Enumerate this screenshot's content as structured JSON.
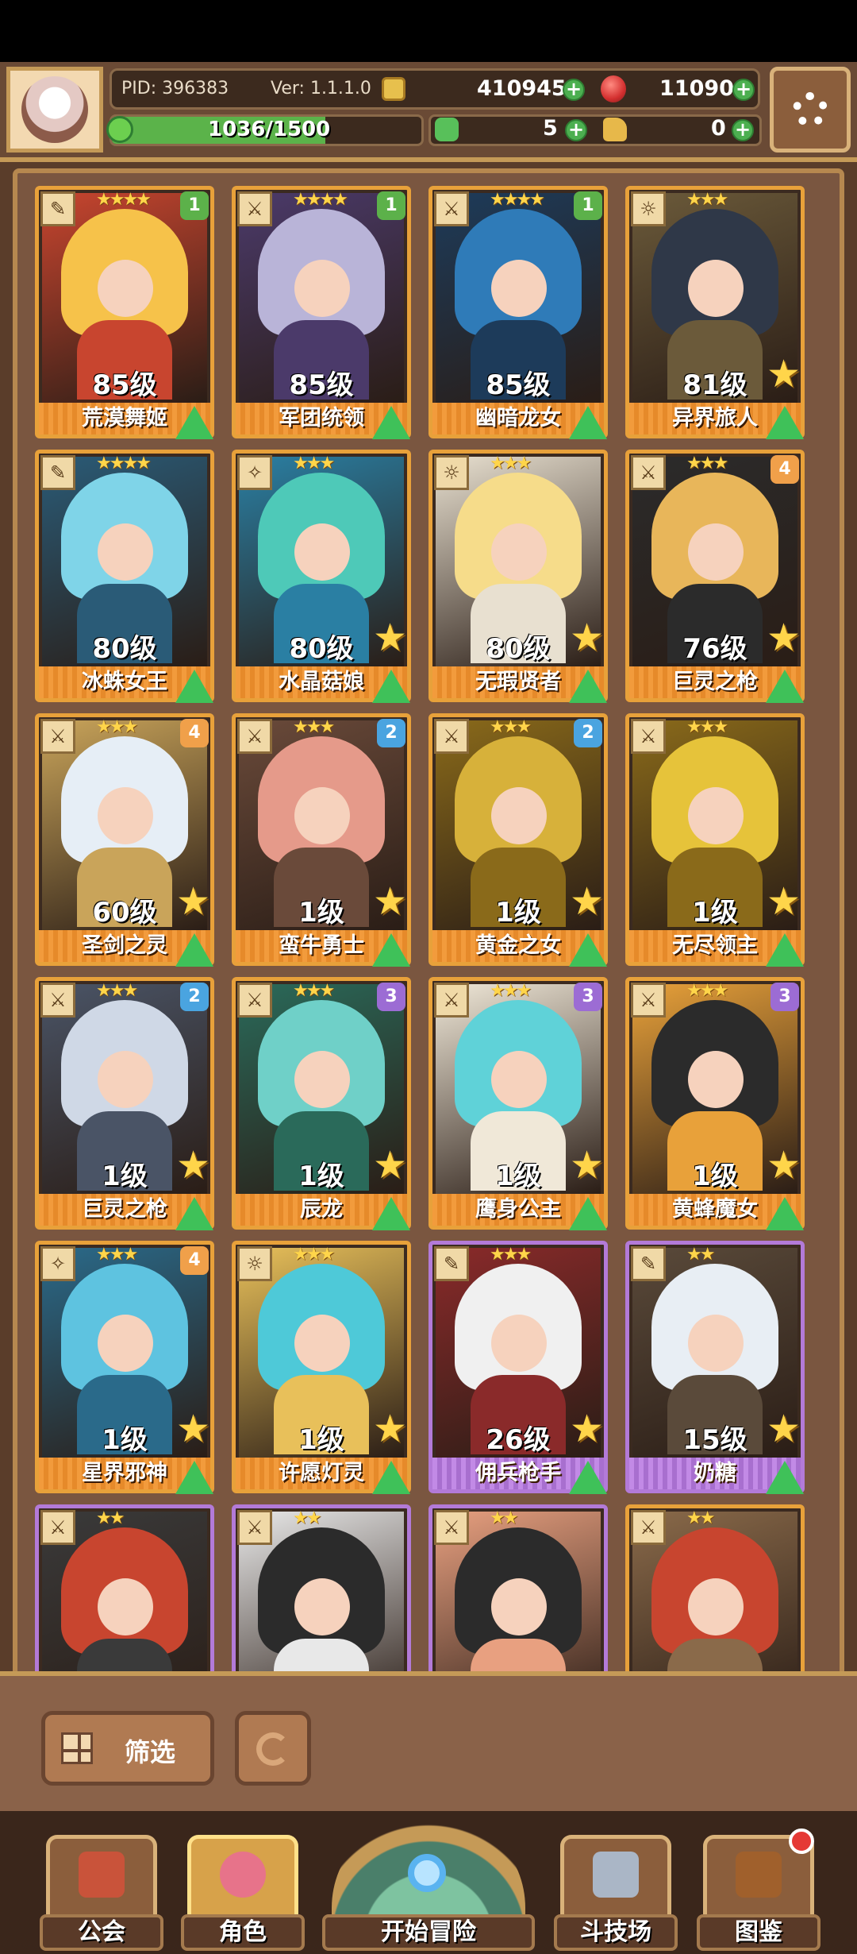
{
  "hud": {
    "pid": "PID: 396383",
    "version": "Ver: 1.1.1.0",
    "coins": "410945",
    "gems": "11090",
    "exp_text": "1036/1500",
    "exp_progress": 0.69,
    "clovers": "5",
    "boots": "0",
    "plus_symbol": "+"
  },
  "cards": [
    {
      "name": "荒漠舞姬",
      "level": "85级",
      "stars": "★★★★",
      "tier": "1",
      "tier_color": "green",
      "frame": "gold",
      "role": "wand",
      "palette": [
        "#f6c24a",
        "#c8452f"
      ],
      "big_star": false
    },
    {
      "name": "军团统领",
      "level": "85级",
      "stars": "★★★★",
      "tier": "1",
      "tier_color": "green",
      "frame": "gold",
      "role": "sword",
      "palette": [
        "#b9b4d8",
        "#4b3a6a"
      ],
      "big_star": false
    },
    {
      "name": "幽暗龙女",
      "level": "85级",
      "stars": "★★★★",
      "tier": "1",
      "tier_color": "green",
      "frame": "gold",
      "role": "sword",
      "palette": [
        "#2f7bb8",
        "#1d3b5a"
      ],
      "big_star": false
    },
    {
      "name": "异界旅人",
      "level": "81级",
      "stars": "★★★",
      "tier": "",
      "tier_color": "",
      "frame": "gold",
      "role": "shield",
      "palette": [
        "#2f3848",
        "#6b5a3a"
      ],
      "big_star": true
    },
    {
      "name": "冰蛛女王",
      "level": "80级",
      "stars": "★★★★",
      "tier": "",
      "tier_color": "",
      "frame": "gold",
      "role": "wand",
      "palette": [
        "#7fd4e8",
        "#2a5b77"
      ],
      "big_star": false
    },
    {
      "name": "水晶菇娘",
      "level": "80级",
      "stars": "★★★",
      "tier": "",
      "tier_color": "",
      "frame": "gold",
      "role": "staff",
      "palette": [
        "#4ec9b8",
        "#2a7fa3"
      ],
      "big_star": true
    },
    {
      "name": "无瑕贤者",
      "level": "80级",
      "stars": "★★★",
      "tier": "",
      "tier_color": "",
      "frame": "gold",
      "role": "shield",
      "palette": [
        "#f6dc8a",
        "#e8e0d0"
      ],
      "big_star": true
    },
    {
      "name": "巨灵之枪",
      "level": "76级",
      "stars": "★★★",
      "tier": "4",
      "tier_color": "orange",
      "frame": "gold",
      "role": "sword",
      "palette": [
        "#e8b65a",
        "#2b2b2b"
      ],
      "big_star": true
    },
    {
      "name": "圣剑之灵",
      "level": "60级",
      "stars": "★★★",
      "tier": "4",
      "tier_color": "orange",
      "frame": "gold",
      "role": "sword",
      "palette": [
        "#e6eef6",
        "#c9a45a"
      ],
      "big_star": true
    },
    {
      "name": "蛮牛勇士",
      "level": "1级",
      "stars": "★★★",
      "tier": "2",
      "tier_color": "blue",
      "frame": "gold",
      "role": "sword",
      "palette": [
        "#e59a8a",
        "#6a4a3a"
      ],
      "big_star": true
    },
    {
      "name": "黄金之女",
      "level": "1级",
      "stars": "★★★",
      "tier": "2",
      "tier_color": "blue",
      "frame": "gold",
      "role": "sword",
      "palette": [
        "#d7b13a",
        "#8a6a1a"
      ],
      "big_star": true
    },
    {
      "name": "无尽领主",
      "level": "1级",
      "stars": "★★★",
      "tier": "",
      "tier_color": "",
      "frame": "gold",
      "role": "sword",
      "palette": [
        "#e6c33a",
        "#8a6a1a"
      ],
      "big_star": true
    },
    {
      "name": "巨灵之枪",
      "level": "1级",
      "stars": "★★★",
      "tier": "2",
      "tier_color": "blue",
      "frame": "gold",
      "role": "sword",
      "palette": [
        "#cfd8e6",
        "#4a5466"
      ],
      "big_star": true
    },
    {
      "name": "辰龙",
      "level": "1级",
      "stars": "★★★",
      "tier": "3",
      "tier_color": "violet",
      "frame": "gold",
      "role": "sword",
      "palette": [
        "#6fd0c8",
        "#2a6a5a"
      ],
      "big_star": true
    },
    {
      "name": "鹰身公主",
      "level": "1级",
      "stars": "★★★",
      "tier": "3",
      "tier_color": "violet",
      "frame": "gold",
      "role": "sword",
      "palette": [
        "#5fd2d8",
        "#f0e8d8"
      ],
      "big_star": true
    },
    {
      "name": "黄蜂魔女",
      "level": "1级",
      "stars": "★★★",
      "tier": "3",
      "tier_color": "violet",
      "frame": "gold",
      "role": "sword",
      "palette": [
        "#2b2b2b",
        "#e8a13a"
      ],
      "big_star": true
    },
    {
      "name": "星界邪神",
      "level": "1级",
      "stars": "★★★",
      "tier": "4",
      "tier_color": "orange",
      "frame": "gold",
      "role": "staff",
      "palette": [
        "#5ec3e0",
        "#2a6a8a"
      ],
      "big_star": true
    },
    {
      "name": "许愿灯灵",
      "level": "1级",
      "stars": "★★★",
      "tier": "",
      "tier_color": "",
      "frame": "gold",
      "role": "shield",
      "palette": [
        "#4ec9d8",
        "#e8c05a"
      ],
      "big_star": true
    },
    {
      "name": "佣兵枪手",
      "level": "26级",
      "stars": "★★★",
      "tier": "",
      "tier_color": "",
      "frame": "purple",
      "role": "wand",
      "palette": [
        "#f0f0f0",
        "#8a2a2a"
      ],
      "big_star": true
    },
    {
      "name": "奶糖",
      "level": "15级",
      "stars": "★★",
      "tier": "",
      "tier_color": "",
      "frame": "purple",
      "role": "wand",
      "palette": [
        "#e8eef4",
        "#5a4a3a"
      ],
      "big_star": true
    },
    {
      "name": "",
      "level": "",
      "stars": "★★",
      "tier": "",
      "tier_color": "",
      "frame": "purple",
      "role": "sword",
      "palette": [
        "#c8452f",
        "#3a3a3a"
      ],
      "big_star": false
    },
    {
      "name": "",
      "level": "",
      "stars": "★★",
      "tier": "",
      "tier_color": "",
      "frame": "purple",
      "role": "sword",
      "palette": [
        "#2b2b2b",
        "#e8e8e8"
      ],
      "big_star": false
    },
    {
      "name": "",
      "level": "",
      "stars": "★★",
      "tier": "",
      "tier_color": "",
      "frame": "purple",
      "role": "sword",
      "palette": [
        "#2b2b2b",
        "#e8a080"
      ],
      "big_star": false
    },
    {
      "name": "",
      "level": "",
      "stars": "★★",
      "tier": "",
      "tier_color": "",
      "frame": "gold",
      "role": "sword",
      "palette": [
        "#c8452f",
        "#8a6a4a"
      ],
      "big_star": false
    }
  ],
  "filter": {
    "label": "筛选"
  },
  "nav": {
    "guild": "公会",
    "roles": "角色",
    "adventure": "开始冒险",
    "arena": "斗技场",
    "codex": "图鉴"
  },
  "icons": {
    "coin": "coin-icon",
    "gem": "gem-icon",
    "settings": "gear-icon",
    "exp": "clover-icon",
    "boots": "boot-icon"
  }
}
